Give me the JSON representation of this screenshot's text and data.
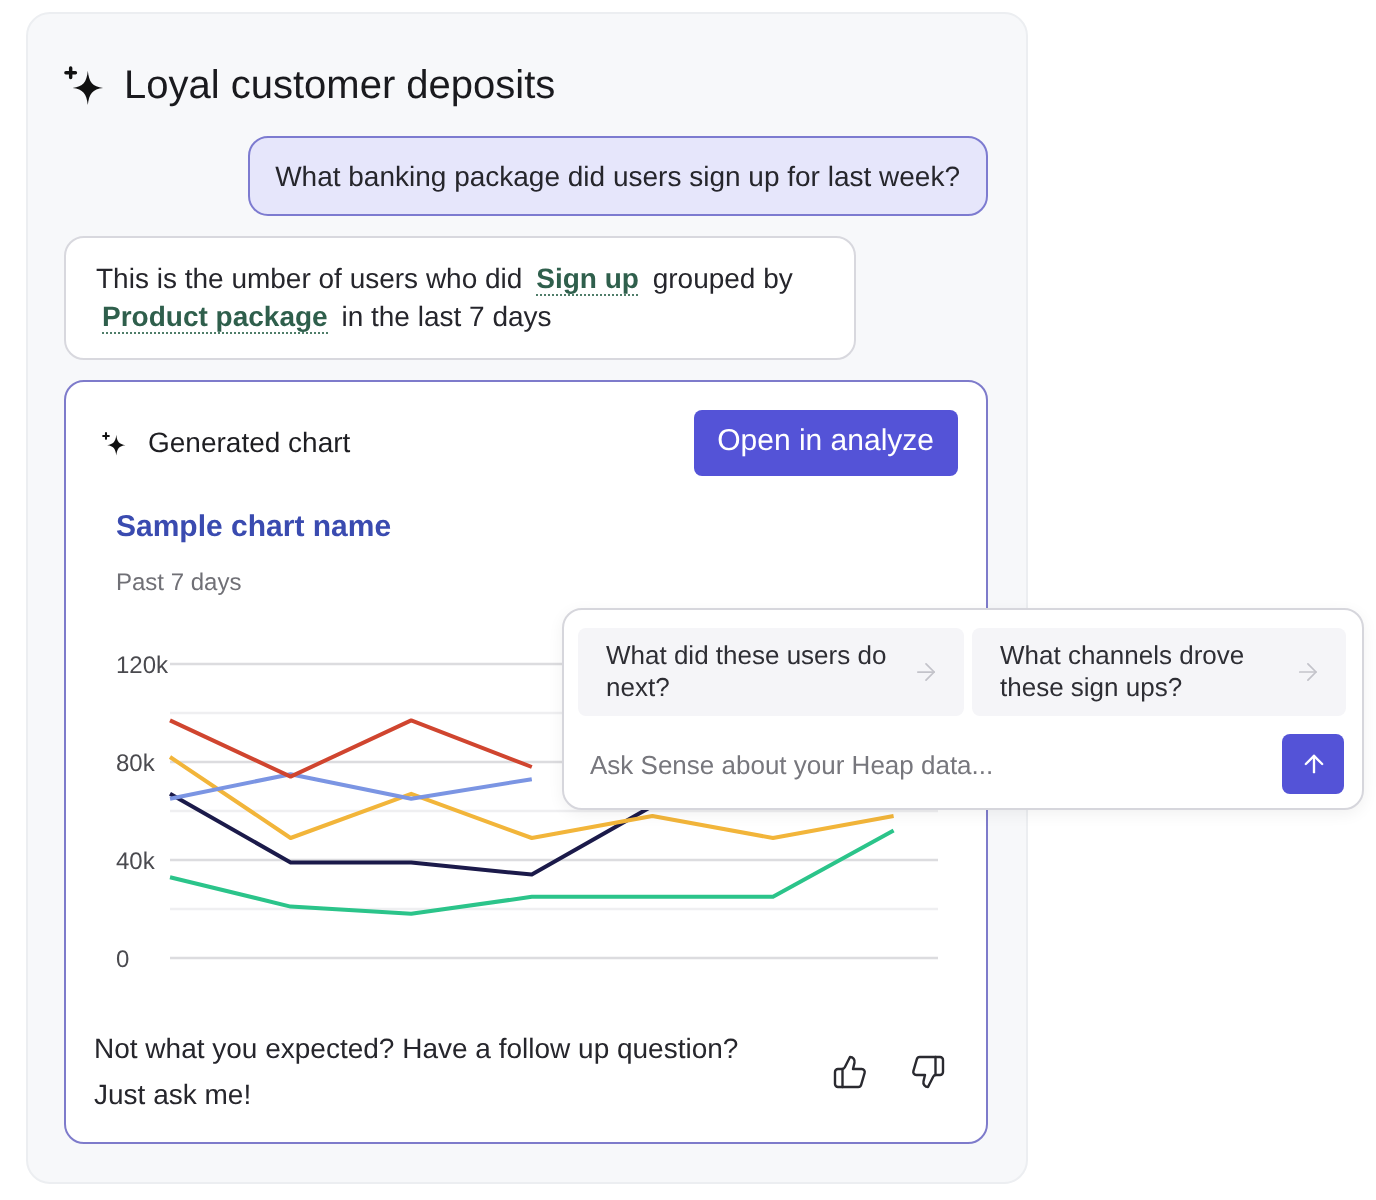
{
  "title": {
    "text": "Loyal customer deposits"
  },
  "user_message": {
    "text": "What banking package did users sign up for last week?"
  },
  "assistant_message": {
    "segments": [
      {
        "kind": "text",
        "text": "This is the umber of users who did"
      },
      {
        "kind": "term",
        "text": "Sign up"
      },
      {
        "kind": "text",
        "text": "grouped by"
      },
      {
        "kind": "term",
        "text": "Product package"
      },
      {
        "kind": "text",
        "text": "in the last 7 days"
      }
    ]
  },
  "chart_card": {
    "heading": "Generated chart",
    "open_button": {
      "label": "Open in analyze"
    },
    "chart_title": "Sample chart name",
    "period": "Past 7 days",
    "chart_data": {
      "type": "line",
      "ylim": [
        0,
        120000
      ],
      "yticks": [
        {
          "value": 0,
          "label": "0"
        },
        {
          "value": 40000,
          "label": "40k"
        },
        {
          "value": 80000,
          "label": "80k"
        },
        {
          "value": 120000,
          "label": "120k"
        }
      ],
      "series": [
        {
          "color": "#2bc48a",
          "values": [
            33000,
            21000,
            18000,
            25000,
            25000,
            25000,
            52000
          ]
        },
        {
          "color": "#1b1a4a",
          "values": [
            67000,
            39000,
            39000,
            34000,
            62000,
            null,
            null
          ]
        },
        {
          "color": "#f2b53a",
          "values": [
            82000,
            49000,
            67000,
            49000,
            58000,
            49000,
            58000
          ]
        },
        {
          "color": "#7b95e3",
          "values": [
            65000,
            75000,
            65000,
            73000,
            null,
            null,
            null
          ]
        },
        {
          "color": "#d0452f",
          "values": [
            97000,
            74000,
            97000,
            78000,
            null,
            null,
            null
          ]
        }
      ]
    },
    "feedback_text": "Not what you expected? Have a follow up question? Just ask me!"
  },
  "suggestion_popup": {
    "suggestions": [
      {
        "text": "What did these users do next?"
      },
      {
        "text": "What channels drove these sign ups?"
      }
    ],
    "input": {
      "placeholder": "Ask Sense about your Heap data..."
    }
  }
}
